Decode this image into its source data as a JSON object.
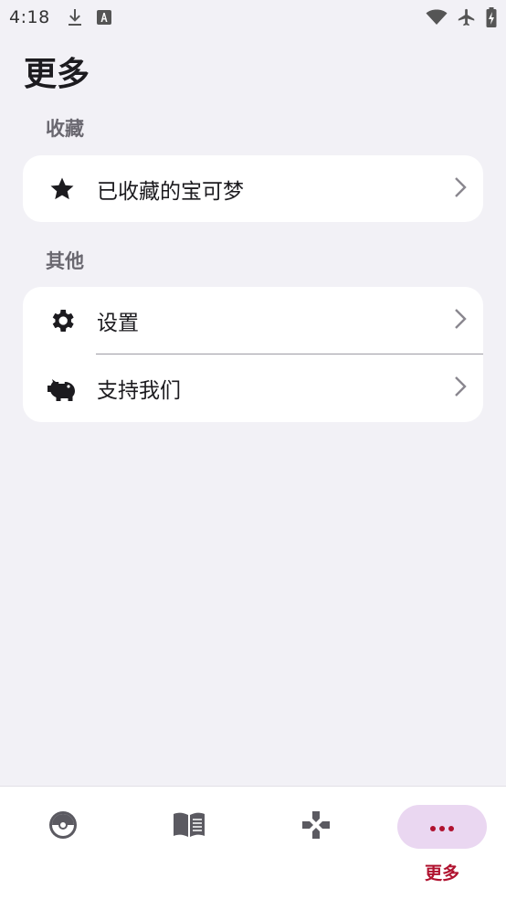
{
  "status_bar": {
    "time": "4:18",
    "icons": [
      "download-icon",
      "font-a-icon",
      "wifi-icon",
      "airplane-icon",
      "battery-charging-icon"
    ]
  },
  "page": {
    "title": "更多"
  },
  "sections": [
    {
      "label": "收藏",
      "items": [
        {
          "label": "已收藏的宝可梦",
          "icon": "star-icon"
        }
      ]
    },
    {
      "label": "其他",
      "items": [
        {
          "label": "设置",
          "icon": "gear-icon"
        },
        {
          "label": "支持我们",
          "icon": "piggy-bank-icon"
        }
      ]
    }
  ],
  "bottom_nav": {
    "items": [
      {
        "icon": "pokeball-icon",
        "label": ""
      },
      {
        "icon": "book-icon",
        "label": ""
      },
      {
        "icon": "gamepad-icon",
        "label": ""
      },
      {
        "icon": "more-dots-icon",
        "label": "更多",
        "active": true
      }
    ]
  },
  "colors": {
    "background": "#f2f1f6",
    "card": "#ffffff",
    "accent": "#b0122f",
    "active_pill": "#ead7f1"
  }
}
